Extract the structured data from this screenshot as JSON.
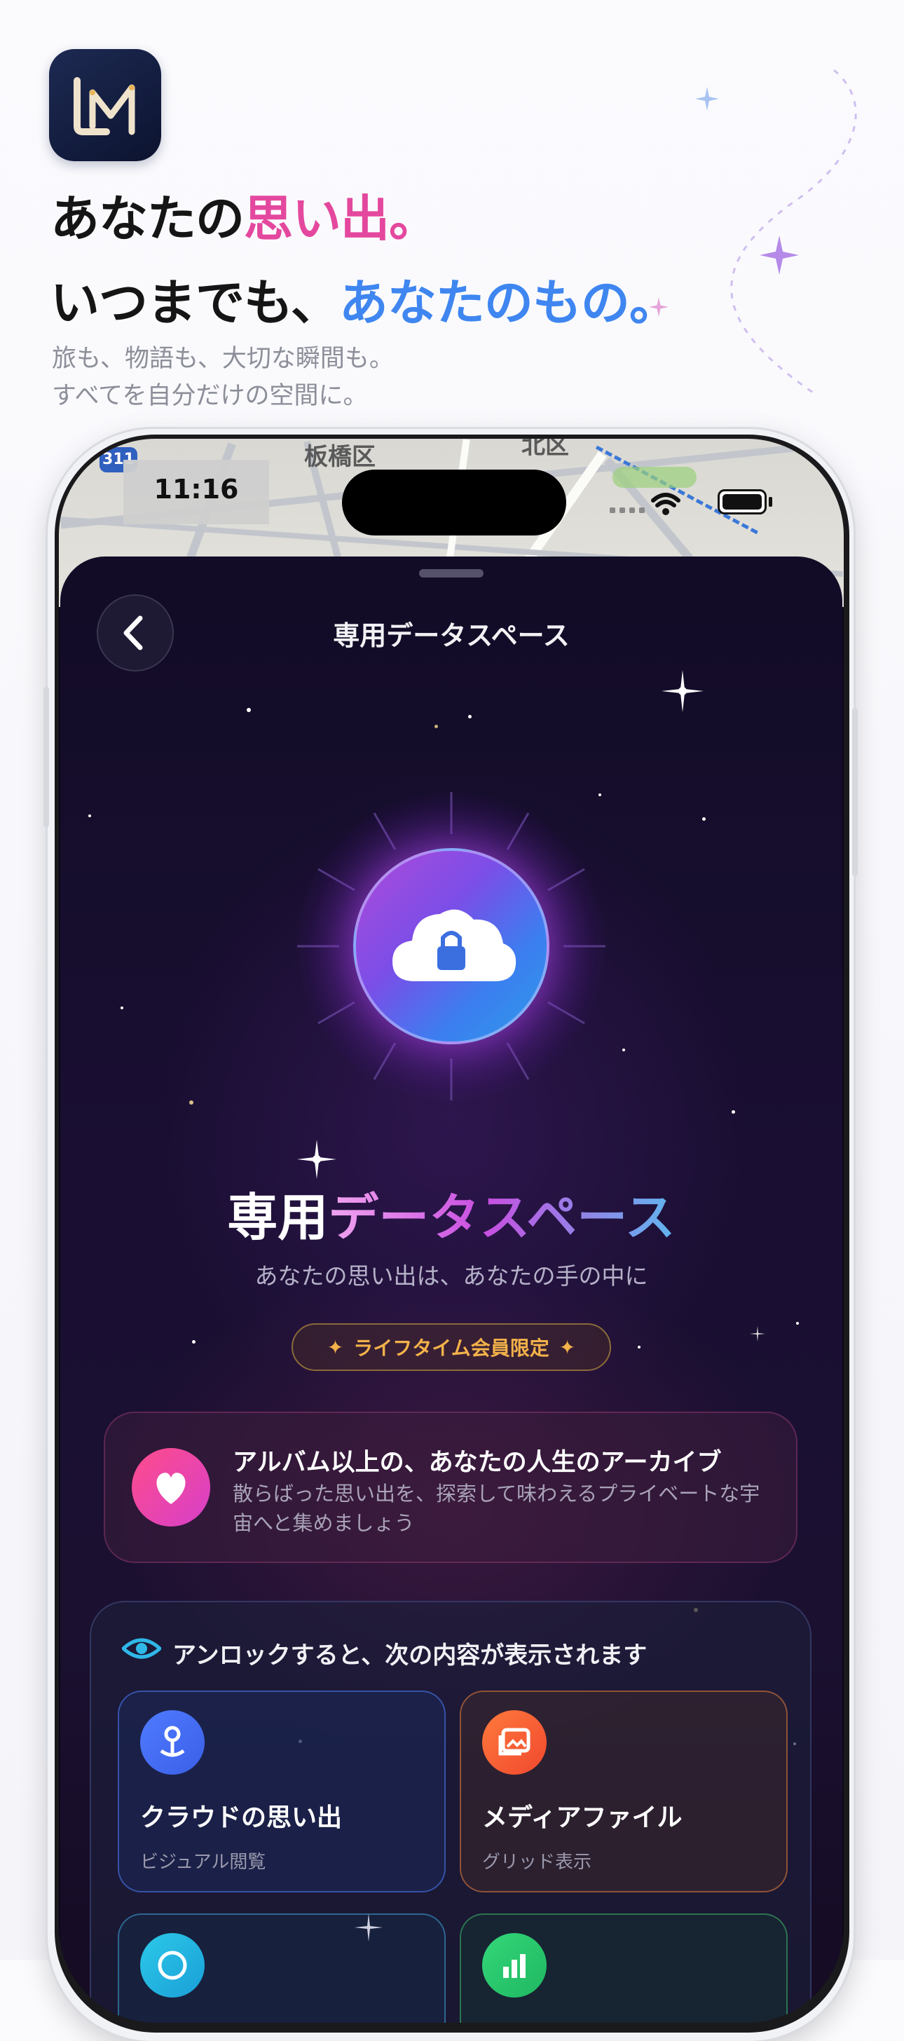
{
  "marketing": {
    "headline_line1_prefix": "あなたの",
    "headline_line1_highlight": "思い出。",
    "headline_line2_prefix": "いつまでも、",
    "headline_line2_highlight": "あなたのもの。",
    "subline_1": "旅も、物語も、大切な瞬間も。",
    "subline_2": "すべてを自分だけの空間に。",
    "app_icon": "lm-logo-icon"
  },
  "status_bar": {
    "time": "11:16",
    "icons": [
      "wifi-icon",
      "battery-icon"
    ]
  },
  "map": {
    "label_1": "板橋区",
    "label_2": "北区",
    "route_badge": "311"
  },
  "sheet": {
    "back_icon": "chevron-left-icon",
    "title": "専用データスペース"
  },
  "hero": {
    "title_part1": "専用",
    "title_part2": "データスペース",
    "subtitle": "あなたの思い出は、あなたの手の中に",
    "badge": "ライフタイム会員限定",
    "orb_icon": "cloud-lock-icon"
  },
  "archive_card": {
    "title": "アルバム以上の、あなたの人生のアーカイブ",
    "description": "散らばった思い出を、探索して味わえるプライベートな宇宙へと集めましょう",
    "icon": "heart-icon"
  },
  "unlock": {
    "title": "アンロックすると、次の内容が表示されます",
    "icon": "eye-icon",
    "features": [
      {
        "title": "クラウドの思い出",
        "subtitle": "ビジュアル閲覧",
        "icon": "map-pin-icon"
      },
      {
        "title": "メディアファイル",
        "subtitle": "グリッド表示",
        "icon": "photos-icon"
      },
      {
        "title": "",
        "subtitle": "",
        "icon": "globe-icon"
      },
      {
        "title": "",
        "subtitle": "",
        "icon": "chart-icon"
      }
    ]
  },
  "colors": {
    "pink": "#e4489e",
    "blue": "#3f86f0",
    "badge_gold": "#f3b24a",
    "sheet_bg": "#140c26"
  }
}
